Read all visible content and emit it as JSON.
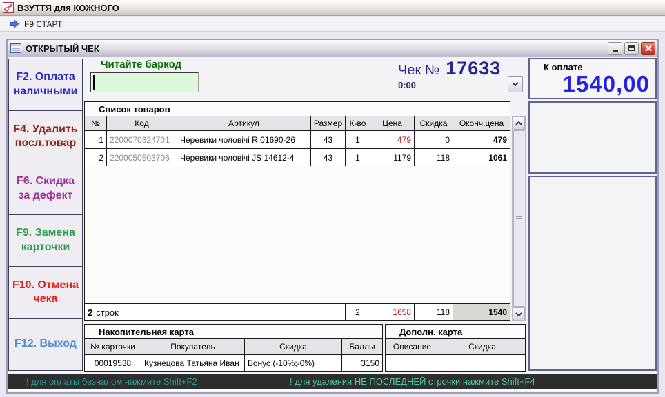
{
  "app": {
    "title": "ВЗУТТЯ для КОЖНОГО",
    "menu_start": "F9 СТАРТ"
  },
  "window": {
    "title": "ОТКРЫТЫЙ ЧЕК"
  },
  "sidebar": {
    "buttons": [
      {
        "id": "f2",
        "label": "F2. Оплата наличными",
        "color": "#2a2ac8"
      },
      {
        "id": "f4",
        "label": "F4. Удалить посл.товар",
        "color": "#8f2619"
      },
      {
        "id": "f6",
        "label": "F6. Скидка за дефект",
        "color": "#a0309a"
      },
      {
        "id": "f9",
        "label": "F9. Замена карточки",
        "color": "#2f9e52"
      },
      {
        "id": "f10",
        "label": "F10. Отмена чека",
        "color": "#e01f1f"
      },
      {
        "id": "f12",
        "label": "F12. Выход",
        "color": "#4a8fd0"
      }
    ]
  },
  "receipt": {
    "barcode_label": "Читайте баркод",
    "barcode_value": "",
    "check_label": "Чек №",
    "check_number": "17633",
    "timer": "0:00",
    "payment_label": "К оплате",
    "payment_amount": "1540,00"
  },
  "items_table": {
    "section_title": "Список товаров",
    "columns": [
      "№",
      "Код",
      "Артикул",
      "Размер",
      "К-во",
      "Цена",
      "Скидка",
      "Оконч.цена"
    ],
    "rows": [
      {
        "num": "1",
        "code": "2200070324701",
        "article": "Черевики чоловічі R 01690-26",
        "size": "43",
        "qty": "1",
        "price": "479",
        "discount": "0",
        "final": "479"
      },
      {
        "num": "2",
        "code": "2200050503706",
        "article": "Черевики чоловічі JS 14612-4",
        "size": "43",
        "qty": "1",
        "price": "1179",
        "discount": "118",
        "final": "1061"
      }
    ],
    "totals": {
      "rows_count": "2",
      "rows_word": "строк",
      "qty": "2",
      "price": "1658",
      "discount": "118",
      "final": "1540"
    }
  },
  "loyalty_card": {
    "title": "Накопительная карта",
    "columns": [
      "№ карточки",
      "Покупатель",
      "Скидка",
      "Баллы"
    ],
    "row": {
      "card_number": "00019538",
      "customer": "Кузнецова Татьяна Иван",
      "discount": "Бонус (-10%;-0%)",
      "points": "3150"
    }
  },
  "extra_card": {
    "title": "Дополн. карта",
    "columns": [
      "Описание",
      "Скидка"
    ],
    "row": {
      "description": "",
      "discount": ""
    }
  },
  "status_bar": {
    "message_1": "! для оплаты безналом нажмите Shift+F2",
    "message_2": "! для удаления НЕ ПОСЛЕДНЕЙ строчки нажмите Shift+F4"
  },
  "colors": {
    "payment_amount_blue": "#2424e0",
    "check_number_navy": "#26268f",
    "price_red": "#c01818",
    "barcode_label_green": "#007000",
    "barcode_input_bg": "#dcf8d8",
    "panel_border": "#5f6390",
    "status_bar_bg": "#2e2e2e",
    "status_message1_teal": "#2f9a93",
    "status_message2_green": "#57c3a4",
    "item_code_gray": "#8a8a8a"
  }
}
